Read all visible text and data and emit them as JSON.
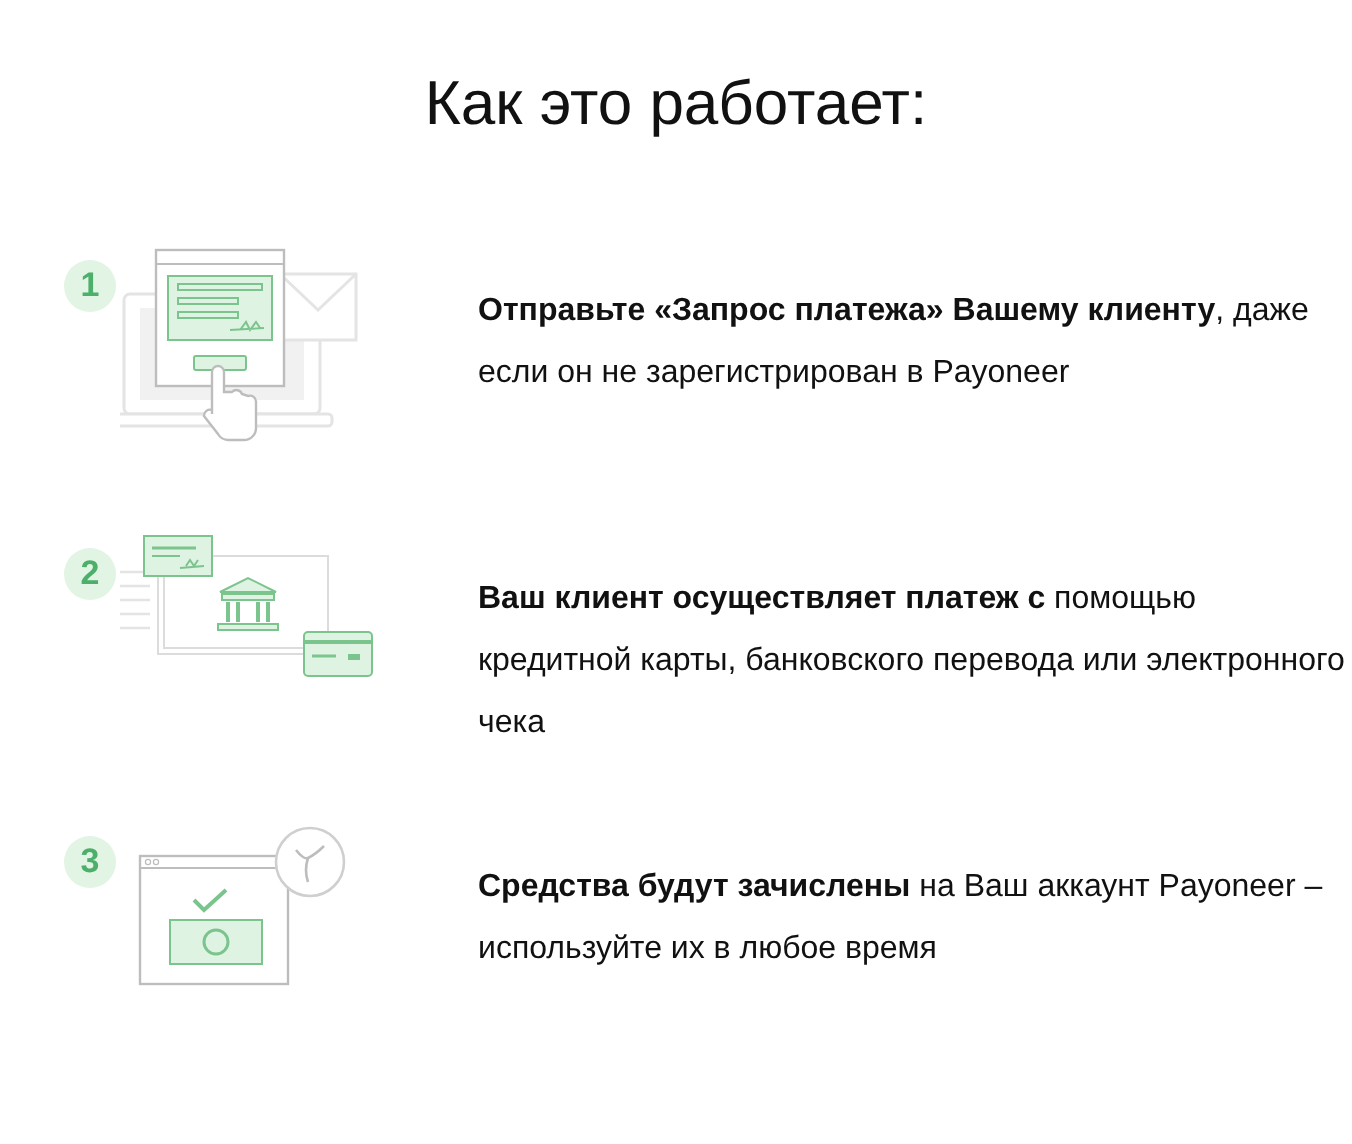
{
  "title": "Как это работает:",
  "steps": [
    {
      "number": "1",
      "kind": "request",
      "text": "**Отправьте «Запрос платежа» Вашему клиенту**, даже если он не зарегистрирован в Payoneer"
    },
    {
      "number": "2",
      "kind": "payment",
      "text": "**Ваш клиент осуществляет платеж с** помощью кредитной карты, банковского перевода или электронного чека"
    },
    {
      "number": "3",
      "kind": "funds",
      "text": "**Средства будут зачислены** на Ваш аккаунт Payoneer – используйте их в любое время"
    }
  ]
}
